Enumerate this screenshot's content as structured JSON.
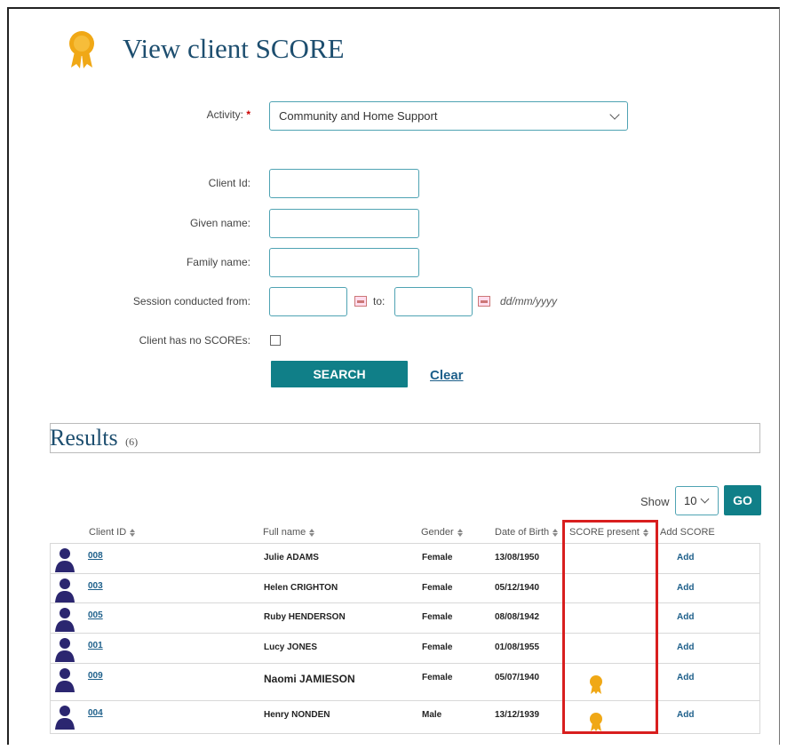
{
  "page": {
    "title": "View client SCORE"
  },
  "form": {
    "activity_label": "Activity:",
    "activity_required": "*",
    "activity_value": "Community and Home Support",
    "client_id_label": "Client Id:",
    "given_name_label": "Given name:",
    "family_name_label": "Family name:",
    "session_from_label": "Session conducted  from:",
    "session_to_label": "to:",
    "date_format": "dd/mm/yyyy",
    "no_scores_label": "Client has no SCOREs:",
    "search_button": "SEARCH",
    "clear_link": "Clear"
  },
  "results": {
    "title": "Results",
    "count": "(6)",
    "show_label": "Show",
    "show_value": "10",
    "go_button": "GO",
    "columns": [
      "Client ID",
      "Full name",
      "Gender",
      "Date of Birth",
      "SCORE present",
      "Add SCORE"
    ],
    "rows": [
      {
        "id": "008",
        "name": "Julie ADAMS",
        "gender": "Female",
        "dob": "13/08/1950",
        "score": false,
        "add": "Add"
      },
      {
        "id": "003",
        "name": "Helen CRIGHTON",
        "gender": "Female",
        "dob": "05/12/1940",
        "score": false,
        "add": "Add"
      },
      {
        "id": "005",
        "name": "Ruby HENDERSON",
        "gender": "Female",
        "dob": "08/08/1942",
        "score": false,
        "add": "Add"
      },
      {
        "id": "001",
        "name": "Lucy JONES",
        "gender": "Female",
        "dob": "01/08/1955",
        "score": false,
        "add": "Add"
      },
      {
        "id": "009",
        "name": "Naomi JAMIESON",
        "gender": "Female",
        "dob": "05/07/1940",
        "score": true,
        "add": "Add"
      },
      {
        "id": "004",
        "name": "Henry NONDEN",
        "gender": "Male",
        "dob": "13/12/1939",
        "score": true,
        "add": "Add"
      }
    ]
  },
  "colors": {
    "accent": "#107f88",
    "title": "#1d4e6f",
    "ribbon": "#f0a816",
    "person": "#2b2670",
    "highlight": "#d81e1e"
  }
}
